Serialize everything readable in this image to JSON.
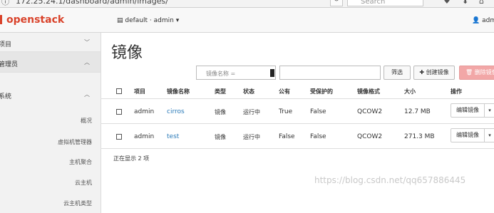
{
  "browser": {
    "url": "172.25.24.1/dashboard/admin/images/",
    "search_placeholder": "Search"
  },
  "header": {
    "logo": "openstack",
    "project": "default · admin",
    "user": "admin"
  },
  "sidebar": {
    "items": [
      {
        "label": "项目",
        "chevron": "﹀"
      },
      {
        "label": "管理员",
        "chevron": "︿"
      },
      {
        "label": "系统",
        "chevron": "︿"
      }
    ],
    "sub_items": [
      "概况",
      "虚拟机管理器",
      "主机聚合",
      "云主机",
      "云主机类型"
    ]
  },
  "main": {
    "title": "镜像",
    "filter_select": "镜像名称 =",
    "filter_button": "筛选",
    "create_button": "创建镜像",
    "delete_button": "删除镜像",
    "columns": [
      "项目",
      "镜像名称",
      "类型",
      "状态",
      "公有",
      "受保护的",
      "镜像格式",
      "大小",
      "操作"
    ],
    "rows": [
      {
        "project": "admin",
        "name": "cirros",
        "type": "镜像",
        "status": "运行中",
        "public": "True",
        "protected": "False",
        "format": "QCOW2",
        "size": "12.7 MB",
        "action": "编辑镜像"
      },
      {
        "project": "admin",
        "name": "test",
        "type": "镜像",
        "status": "运行中",
        "public": "False",
        "protected": "False",
        "format": "QCOW2",
        "size": "271.3 MB",
        "action": "编辑镜像"
      }
    ],
    "count_text": "正在显示 2 项"
  },
  "watermark": "https://blog.csdn.net/qq657886445"
}
